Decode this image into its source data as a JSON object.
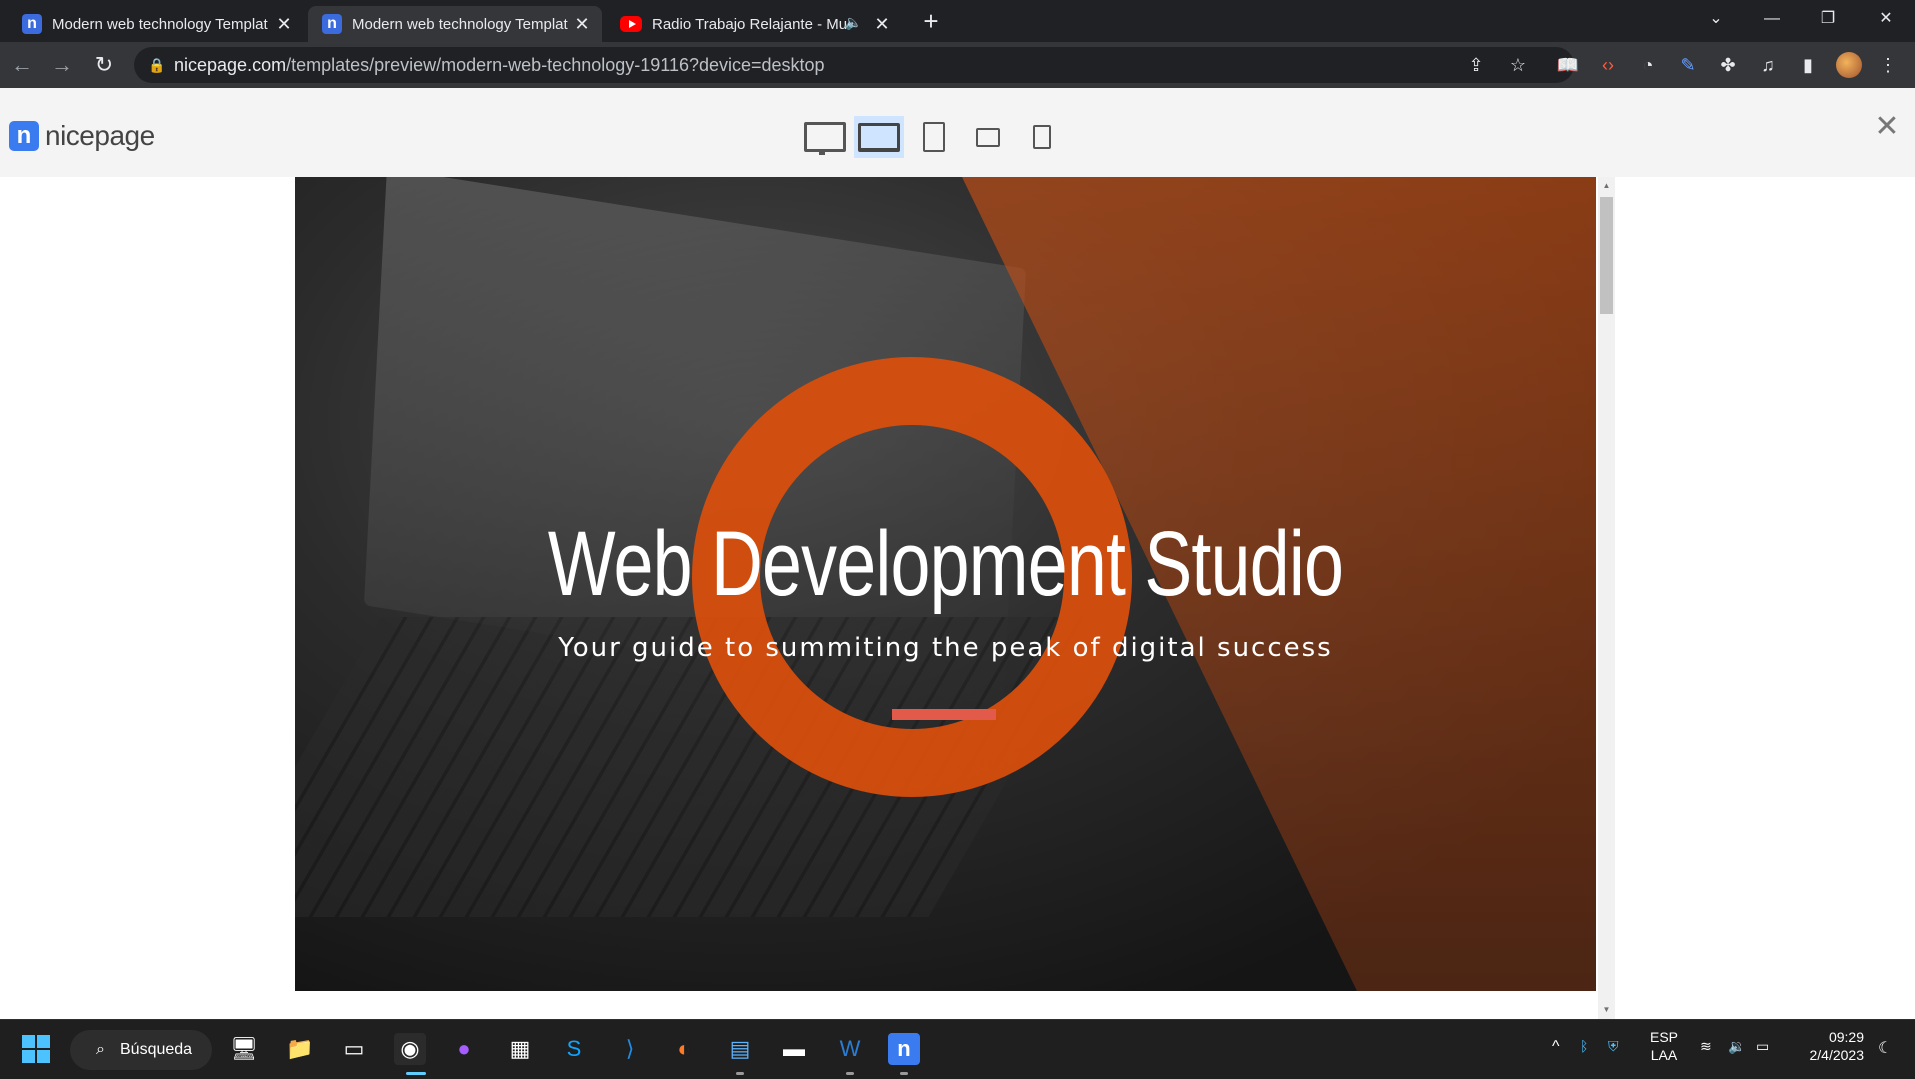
{
  "tabs": [
    {
      "title": "Modern web technology Templat",
      "favicon": "nicepage-icon",
      "active": false
    },
    {
      "title": "Modern web technology Templat",
      "favicon": "nicepage-icon",
      "active": true
    },
    {
      "title": "Radio Trabajo Relajante - Mu",
      "favicon": "youtube-icon",
      "active": false
    }
  ],
  "address": {
    "host": "nicepage.com",
    "path": "/templates/preview/modern-web-technology-19116?device=desktop"
  },
  "nicepage": {
    "logo_mark": "n",
    "logo_word": "nicepage",
    "devices": [
      "desktop",
      "laptop",
      "tablet",
      "tablet-landscape",
      "phone"
    ],
    "active_device": "laptop"
  },
  "hero": {
    "title": "Web Development Studio",
    "subtitle": "Your guide to summiting the peak of digital success",
    "accent_color": "#d94f0c",
    "line_color": "#e25a4a"
  },
  "taskbar": {
    "search_label": "Búsqueda",
    "lang_top": "ESP",
    "lang_bottom": "LAA",
    "time": "09:29",
    "date": "2/4/2023"
  }
}
